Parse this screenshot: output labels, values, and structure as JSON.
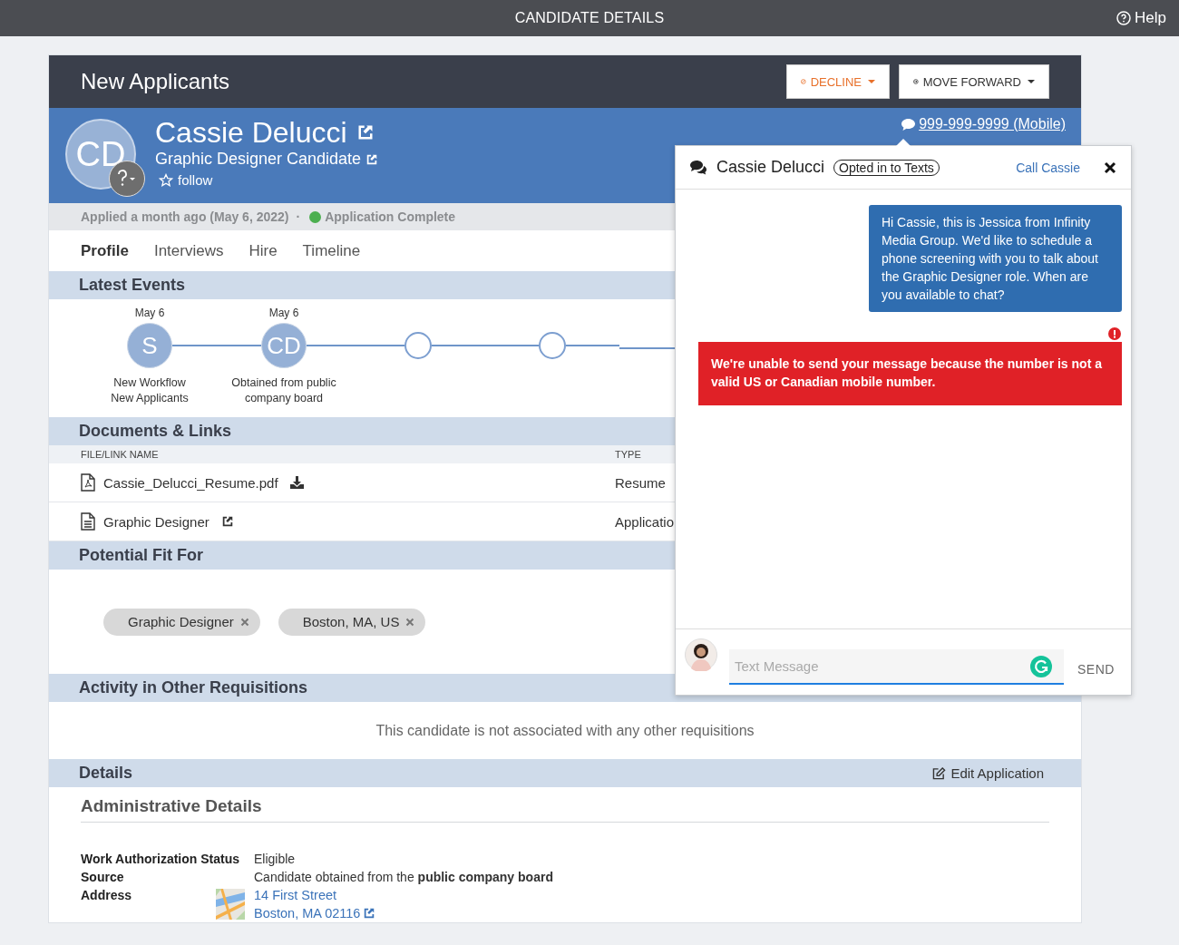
{
  "top_bar": {
    "title": "CANDIDATE DETAILS",
    "help": "Help"
  },
  "header": {
    "title": "New Applicants",
    "buttons": [
      {
        "label": "DECLINE",
        "kind": "decline"
      },
      {
        "label": "MOVE FORWARD",
        "kind": "forward"
      }
    ]
  },
  "candidate": {
    "initials": "CD",
    "name": "Cassie Delucci",
    "role": "Graphic Designer Candidate",
    "follow": "follow",
    "following": false,
    "phone": "999-999-9999 (Mobile)"
  },
  "status": {
    "applied": "Applied a month ago (May 6, 2022)",
    "separator": "·",
    "state": "Application Complete",
    "color": "#4caf50"
  },
  "tabs": [
    {
      "label": "Profile",
      "selected": true
    },
    {
      "label": "Interviews",
      "selected": false
    },
    {
      "label": "Hire",
      "selected": false
    },
    {
      "label": "Timeline",
      "selected": false
    }
  ],
  "latest_events": {
    "title": "Latest Events",
    "events": [
      {
        "kind": "done",
        "date": "May 6",
        "initials": "S",
        "lines": [
          "New Workflow",
          "New Applicants"
        ]
      },
      {
        "kind": "done",
        "date": "May 6",
        "initials": "CD",
        "lines": [
          "Obtained from public",
          "company board"
        ]
      },
      {
        "kind": "pending"
      },
      {
        "kind": "pending"
      }
    ]
  },
  "documents": {
    "title": "Documents & Links",
    "columns": [
      "FILE/LINK NAME",
      "TYPE"
    ],
    "rows": [
      {
        "kind": "pdf",
        "name": "Cassie_Delucci_Resume.pdf",
        "type": "Resume"
      },
      {
        "kind": "doc",
        "name": "Graphic Designer",
        "type": "Applicatio"
      }
    ]
  },
  "potential_fit": {
    "title": "Potential Fit For",
    "tags": [
      "Graphic Designer",
      "Boston, MA, US"
    ]
  },
  "other_requisitions": {
    "title": "Activity in Other Requisitions",
    "message": "This candidate is not associated with any other requisitions"
  },
  "details": {
    "title": "Details",
    "edit": "Edit Application",
    "subtitle": "Administrative Details",
    "fields": [
      {
        "kind": "text",
        "label": "Work Authorization Status",
        "value": "Eligible"
      },
      {
        "kind": "text",
        "label": "Source",
        "value": "Candidate obtained from the **public company board**"
      },
      {
        "kind": "address",
        "label": "Address",
        "lines": [
          "14 First Street",
          "Boston, MA 02116"
        ]
      }
    ]
  },
  "chat": {
    "name": "Cassie Delucci",
    "badge": "Opted in to Texts",
    "call": "Call Cassie",
    "messages": [
      {
        "kind": "outgoing",
        "text": "Hi Cassie, this is Jessica from Infinity Media Group. We'd like to schedule a phone screening with you to talk about the Graphic Designer role. When are you available to chat?"
      }
    ],
    "error": "We're unable to send your message because the number is not a valid US or Canadian mobile number.",
    "placeholder": "Text Message",
    "send": "SEND"
  }
}
